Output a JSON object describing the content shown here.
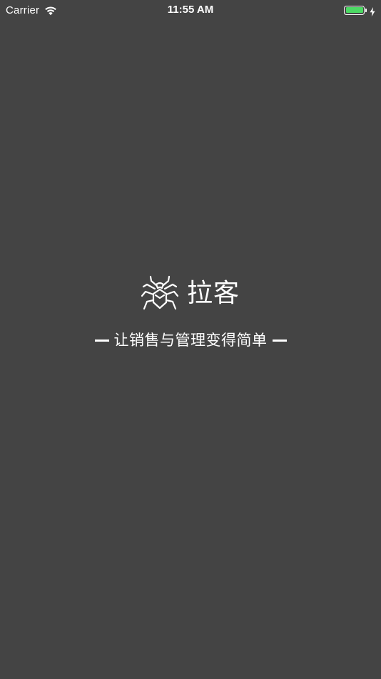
{
  "status_bar": {
    "carrier": "Carrier",
    "time": "11:55 AM",
    "battery_level": 1.0,
    "battery_color": "#4cd964",
    "wifi_icon": "wifi-icon",
    "charging_icon": "charging-bolt-icon"
  },
  "splash": {
    "logo_icon": "spider-icon",
    "app_name": "拉客",
    "tagline": "让销售与管理变得简单",
    "background_color": "#444444"
  }
}
